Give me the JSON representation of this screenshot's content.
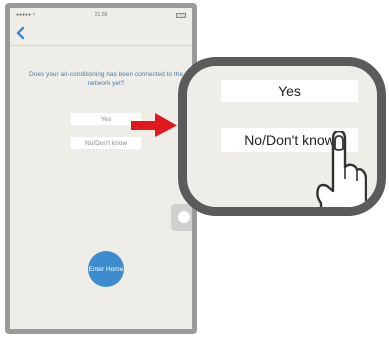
{
  "status_bar": {
    "signal": "●●●●● ≈",
    "time": "21:09"
  },
  "screen": {
    "question": "Does your air-conditioning has been connected to the network yet?",
    "yes_label": "Yes",
    "no_label": "No/Don't know",
    "enter_home_label": "Enter Home"
  },
  "zoom": {
    "yes_label": "Yes",
    "no_label": "No/Don't know"
  },
  "colors": {
    "accent_blue": "#3d8ccd",
    "question_text": "#4b7fae",
    "arrow_red": "#e0191e",
    "frame_gray": "#5b5b5b",
    "screen_bg": "#efede7"
  },
  "icons": [
    "back-chevron-icon",
    "battery-icon",
    "assistive-touch-icon",
    "arrow-right-icon",
    "finger-pointer-icon"
  ]
}
